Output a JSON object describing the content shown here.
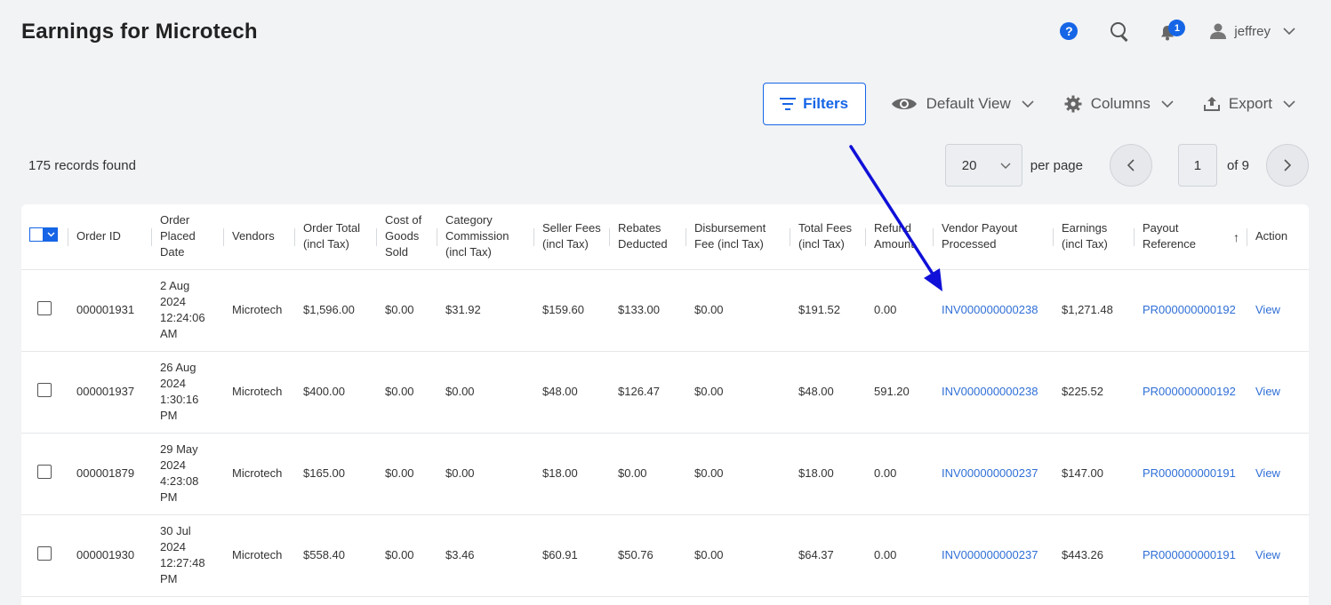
{
  "page": {
    "title": "Earnings for Microtech"
  },
  "topbar": {
    "help_glyph": "?",
    "notification_count": "1",
    "user_name": "jeffrey"
  },
  "toolbar": {
    "filters_label": "Filters",
    "view_label": "Default View",
    "columns_label": "Columns",
    "export_label": "Export"
  },
  "records": {
    "count_text": "175 records found"
  },
  "pagination": {
    "per_page_value": "20",
    "per_page_label": "per page",
    "current_page": "1",
    "of_total": "of 9"
  },
  "table": {
    "headers": {
      "order_id": "Order ID",
      "order_placed_date": "Order Placed Date",
      "vendors": "Vendors",
      "order_total": "Order Total (incl Tax)",
      "cost_of_goods": "Cost of Goods Sold",
      "category_commission": "Category Commission (incl Tax)",
      "seller_fees": "Seller Fees (incl Tax)",
      "rebates_deducted": "Rebates Deducted",
      "disbursement_fee": "Disbursement Fee (incl Tax)",
      "total_fees": "Total Fees (incl Tax)",
      "refund_amount": "Refund Amount",
      "vendor_payout": "Vendor Payout Processed",
      "earnings": "Earnings (incl Tax)",
      "payout_reference": "Payout Reference",
      "sort_glyph": "↑",
      "action": "Action"
    },
    "rows": [
      {
        "order_id": "000001931",
        "date": "2 Aug 2024 12:24:06 AM",
        "vendor": "Microtech",
        "order_total": "$1,596.00",
        "cogs": "$0.00",
        "commission": "$31.92",
        "seller_fees": "$159.60",
        "rebates": "$133.00",
        "disbursement": "$0.00",
        "total_fees": "$191.52",
        "refund": "0.00",
        "invoice": "INV000000000238",
        "earnings": "$1,271.48",
        "payout_ref": "PR000000000192",
        "action": "View"
      },
      {
        "order_id": "000001937",
        "date": "26 Aug 2024 1:30:16 PM",
        "vendor": "Microtech",
        "order_total": "$400.00",
        "cogs": "$0.00",
        "commission": "$0.00",
        "seller_fees": "$48.00",
        "rebates": "$126.47",
        "disbursement": "$0.00",
        "total_fees": "$48.00",
        "refund": "591.20",
        "invoice": "INV000000000238",
        "earnings": "$225.52",
        "payout_ref": "PR000000000192",
        "action": "View"
      },
      {
        "order_id": "000001879",
        "date": "29 May 2024 4:23:08 PM",
        "vendor": "Microtech",
        "order_total": "$165.00",
        "cogs": "$0.00",
        "commission": "$0.00",
        "seller_fees": "$18.00",
        "rebates": "$0.00",
        "disbursement": "$0.00",
        "total_fees": "$18.00",
        "refund": "0.00",
        "invoice": "INV000000000237",
        "earnings": "$147.00",
        "payout_ref": "PR000000000191",
        "action": "View"
      },
      {
        "order_id": "000001930",
        "date": "30 Jul 2024 12:27:48 PM",
        "vendor": "Microtech",
        "order_total": "$558.40",
        "cogs": "$0.00",
        "commission": "$3.46",
        "seller_fees": "$60.91",
        "rebates": "$50.76",
        "disbursement": "$0.00",
        "total_fees": "$64.37",
        "refund": "0.00",
        "invoice": "INV000000000237",
        "earnings": "$443.26",
        "payout_ref": "PR000000000191",
        "action": "View"
      }
    ]
  },
  "colors": {
    "primary": "#1565e6",
    "link": "#2f6fd6",
    "arrow": "#1010d8"
  }
}
